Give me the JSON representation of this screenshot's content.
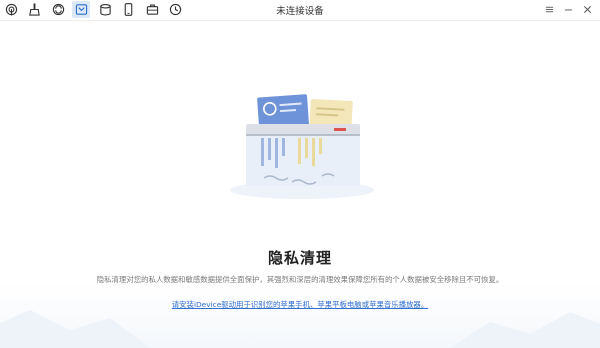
{
  "window": {
    "title": "未连接设备"
  },
  "toolbar": {
    "items": [
      {
        "icon": "signal-icon"
      },
      {
        "icon": "broom-icon"
      },
      {
        "icon": "sync-icon"
      },
      {
        "icon": "privacy-shield-icon",
        "active": true
      },
      {
        "icon": "storage-icon"
      },
      {
        "icon": "phone-icon"
      },
      {
        "icon": "toolbox-icon"
      },
      {
        "icon": "history-icon"
      }
    ]
  },
  "page": {
    "title": "隐私清理",
    "description": "隐私清理对您的私人数据和敏感数据提供全面保护，其强烈和深层的清理效果保障您所有的个人数据被安全移除且不可恢复。",
    "install_link": "请安装iDevice驱动用于识别您的苹果手机、苹果平板电脑或苹果音乐播放器。"
  },
  "colors": {
    "accent": "#2f6fd0",
    "active_tab_bg": "#dbe9f8",
    "card_blue": "#6f93d8",
    "card_yellow": "#f3e6b8"
  }
}
